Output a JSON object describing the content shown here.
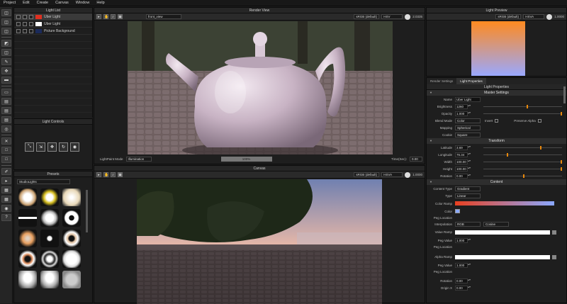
{
  "menu": [
    "Project",
    "Edit",
    "Create",
    "Canvas",
    "Window",
    "Help"
  ],
  "toolbar_icons": [
    "eraser-icon",
    "eraser-icon",
    "eraser-icon",
    "bucket-icon",
    "eraser-icon",
    "pen-icon",
    "move-icon",
    "brush-icon",
    "gradient-icon",
    "layout-icon",
    "layout-icon",
    "layout-icon",
    "stamp-icon",
    "close-icon",
    "square-icon",
    "square-icon",
    "picker-icon",
    "arrow-icon",
    "grid-icon",
    "grid-icon",
    "camera-icon",
    "help-icon"
  ],
  "light_list": {
    "title": "Light List",
    "items": [
      {
        "label": "Uber Light",
        "swatch": "#e03020",
        "selected": true
      },
      {
        "label": "Uber Light",
        "swatch": "#ffffff",
        "selected": false
      },
      {
        "label": "Picture Background",
        "swatch": "#1a2a5a",
        "selected": false
      }
    ]
  },
  "light_controls": {
    "title": "Light Controls",
    "buttons": [
      "transform-icon",
      "scale-icon",
      "move-icon",
      "rotate-icon",
      "target-icon"
    ]
  },
  "presets": {
    "title": "Presets",
    "selected": "StudioLights"
  },
  "render_view": {
    "title": "Render View",
    "view_select": "front_view",
    "color_space": "sRGB (default)",
    "color_model": "HSV",
    "value": "2.0335",
    "mode_label": "LightPaint Mode",
    "mode_value": "Illumination",
    "progress": "100%",
    "time_label": "Time(Sec):",
    "time_value": "0.00"
  },
  "canvas": {
    "title": "Canvas",
    "color_space": "sRGB (default)",
    "color_model": "HSVA",
    "value": "1.0000"
  },
  "light_preview": {
    "title": "Light Preview",
    "color_space": "sRGB (default)",
    "color_model": "HSVA",
    "value": "1.0000"
  },
  "props_tabs": [
    "Render Settings",
    "Light Properties"
  ],
  "props_title": "Light Properties",
  "master": {
    "title": "Master Settings",
    "name_label": "Name",
    "name_value": "Uber Light",
    "brightness_label": "Brightness",
    "brightness_value": "1260",
    "opacity_label": "Opacity",
    "opacity_value": "1.000",
    "blend_label": "Blend Mode",
    "blend_value": "Color",
    "invert_label": "Invert",
    "preserve_label": "Preserve Alpha",
    "mapping_label": "Mapping",
    "mapping_value": "Spherical",
    "cookie_label": "Cookie",
    "cookie_value": "Square"
  },
  "transform": {
    "title": "Transform",
    "rows": [
      {
        "label": "Latitude",
        "value": "3.69"
      },
      {
        "label": "Longitude",
        "value": "76.34"
      },
      {
        "label": "Width",
        "value": "100.00"
      },
      {
        "label": "Height",
        "value": "100.00"
      },
      {
        "label": "Rotation",
        "value": "0.00"
      }
    ]
  },
  "content": {
    "title": "Content",
    "type_label": "Content Type",
    "type_value": "Gradient",
    "type2_label": "Type",
    "type2_value": "Linear",
    "ramp_label": "Color Ramp",
    "color_label": "Color",
    "pos_label": "Peg Location",
    "interp_label": "Interpolation",
    "interp_value": "RGB",
    "interp_value2": "Cosine",
    "value_ramp_label": "Value Ramp",
    "peg_value_label": "Peg Value",
    "peg_value": "1.000",
    "peg_location_label": "Peg Location",
    "alpha_ramp_label": "Alpha Ramp",
    "peg_value2_label": "Peg Value",
    "peg_value2": "1.000",
    "peg_location2_label": "Peg Location",
    "rotation_label": "Rotation",
    "rotation_value": "0.00",
    "origin_label": "Origin X",
    "origin_value": "0.00"
  },
  "colors": {
    "accent": "#e8880c",
    "ramp_start": "#e84020",
    "ramp_end": "#8aa8ff",
    "preview_top": "#ff8a20",
    "preview_bottom": "#9aa8ff"
  }
}
